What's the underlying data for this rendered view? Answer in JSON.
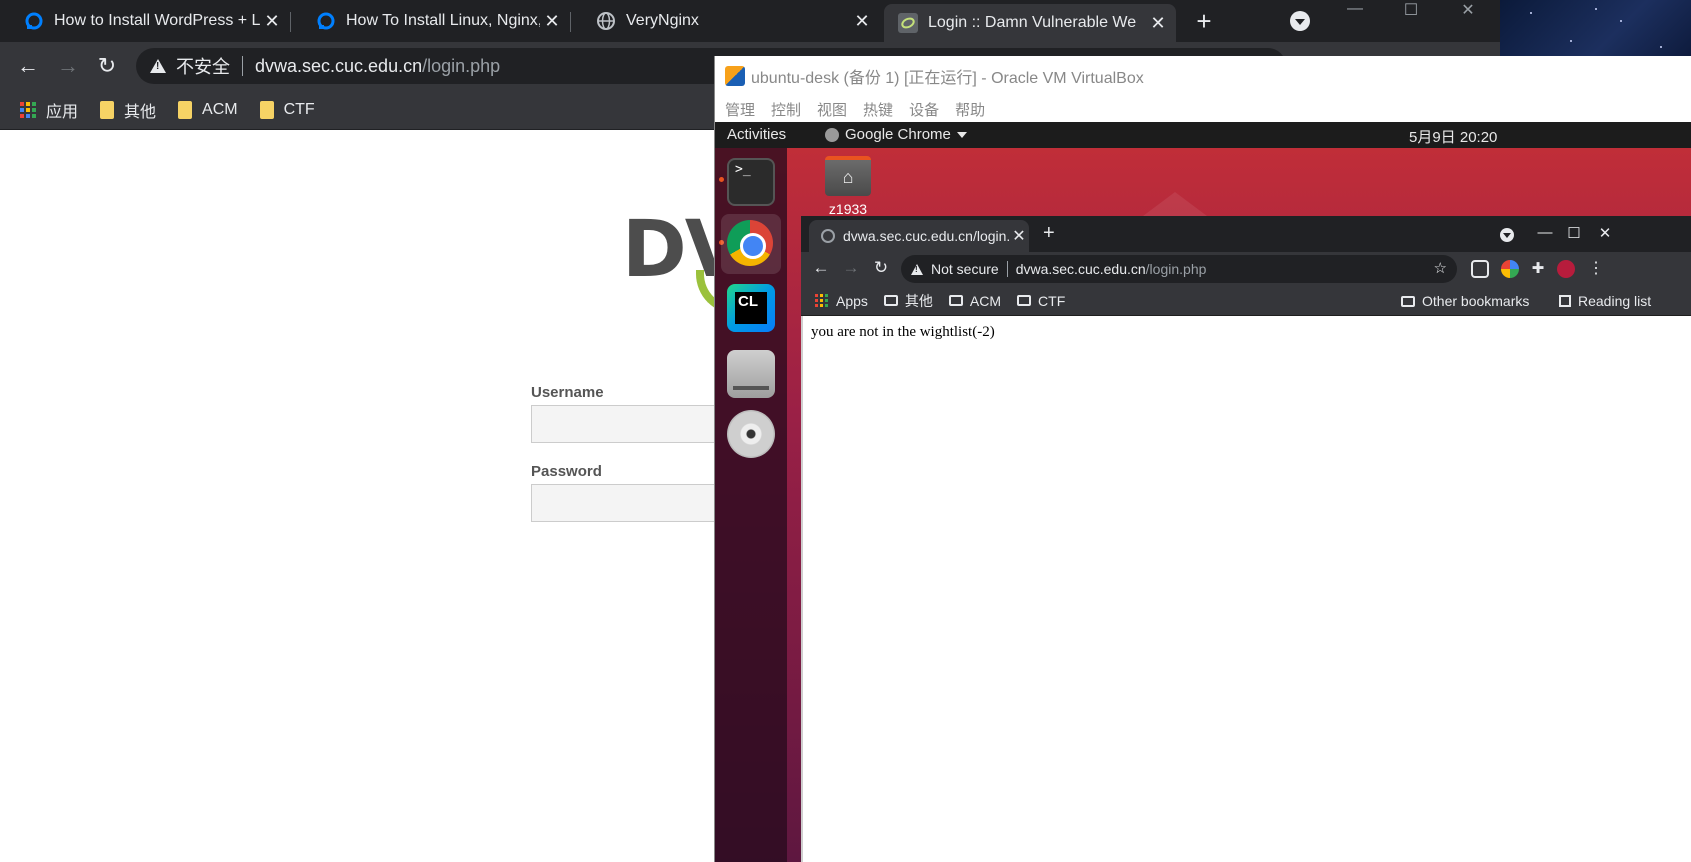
{
  "host": {
    "tabs": [
      {
        "title": "How to Install WordPress + L",
        "favicon": "digitalocean-icon"
      },
      {
        "title": "How To Install Linux, Nginx, M",
        "favicon": "digitalocean-icon"
      },
      {
        "title": "VeryNginx",
        "favicon": "globe-icon"
      },
      {
        "title": "Login :: Damn Vulnerable We",
        "favicon": "dvwa-icon"
      }
    ],
    "new_tab": "+",
    "close": "✕",
    "insecure_label": "不安全",
    "url_host": "dvwa.sec.cuc.edu.cn",
    "url_path": "/login.php",
    "bookmarks": [
      "应用",
      "其他",
      "ACM",
      "CTF"
    ]
  },
  "dvwa": {
    "logo_text": "DV",
    "username_label": "Username",
    "password_label": "Password"
  },
  "vbox": {
    "title": "ubuntu-desk (备份 1) [正在运行] - Oracle VM VirtualBox",
    "menu": [
      "管理",
      "控制",
      "视图",
      "热键",
      "设备",
      "帮助"
    ]
  },
  "ubuntu": {
    "activities": "Activities",
    "app_name": "Google Chrome",
    "clock": "5月9日  20:20",
    "terminal_prompt": ">_",
    "clion_label": "CL",
    "desktop_icon_label": "z1933"
  },
  "guest_chrome": {
    "tab_title": "dvwa.sec.cuc.edu.cn/login.php",
    "insecure_label": "Not secure",
    "url_host": "dvwa.sec.cuc.edu.cn",
    "url_path": "/login.php",
    "bookmarks": [
      "Apps",
      "其他",
      "ACM",
      "CTF"
    ],
    "other_bookmarks": "Other bookmarks",
    "reading_list": "Reading list",
    "message": "you are not in the wightlist(-2)"
  },
  "colors": {
    "chrome_dark": "#202124",
    "chrome_toolbar": "#35363a",
    "ubuntu_orange": "#e95420",
    "dvwa_green": "#9bc13c"
  }
}
